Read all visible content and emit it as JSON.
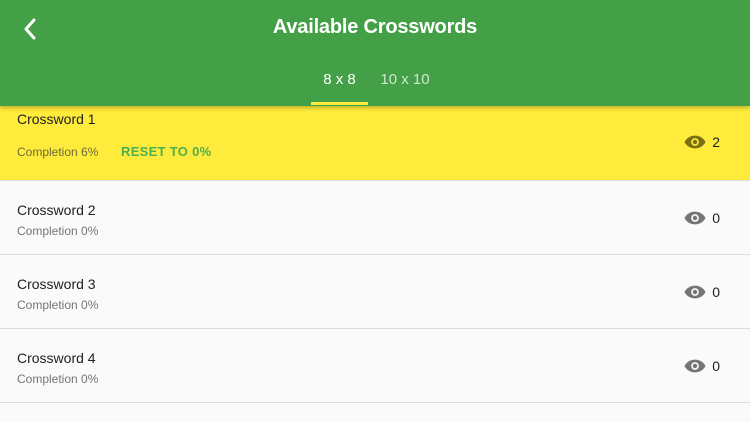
{
  "header": {
    "title": "Available Crosswords",
    "back_icon": "chevron-left-icon"
  },
  "tabs": [
    {
      "label": "8 x 8",
      "selected": true
    },
    {
      "label": "10 x 10",
      "selected": false
    }
  ],
  "colors": {
    "appbar": "#43a047",
    "tab_indicator": "#ffeb3b",
    "active_row": "#ffeb3b",
    "reset_text": "#4caf50"
  },
  "crosswords": [
    {
      "title": "Crossword 1",
      "completion": "Completion 6%",
      "reset_label": "RESET TO 0%",
      "views": "2",
      "view_icon": "eye-icon",
      "active": true
    },
    {
      "title": "Crossword 2",
      "completion": "Completion 0%",
      "views": "0",
      "view_icon": "eye-icon",
      "active": false
    },
    {
      "title": "Crossword 3",
      "completion": "Completion 0%",
      "views": "0",
      "view_icon": "eye-icon",
      "active": false
    },
    {
      "title": "Crossword 4",
      "completion": "Completion 0%",
      "views": "0",
      "view_icon": "eye-icon",
      "active": false
    }
  ]
}
